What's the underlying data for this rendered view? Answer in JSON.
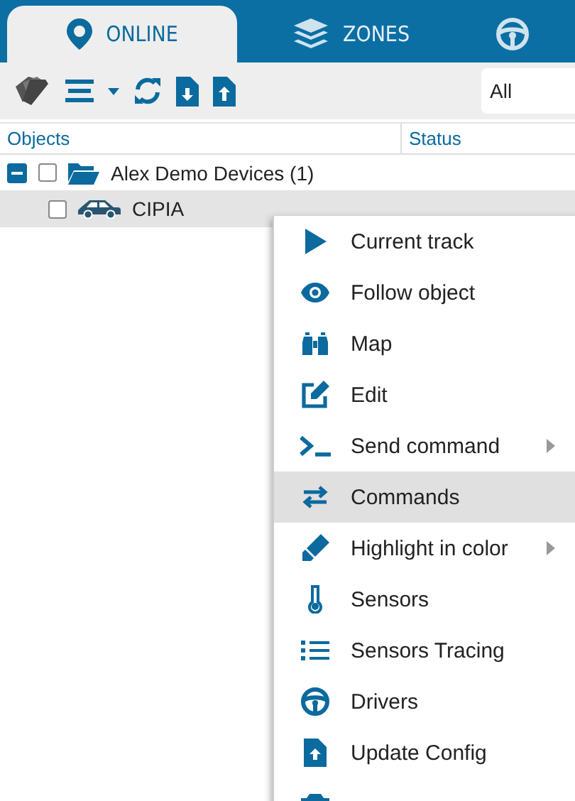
{
  "tabs": [
    {
      "label": "ONLINE",
      "selected": true
    },
    {
      "label": "ZONES",
      "selected": false
    },
    {
      "selected": false
    }
  ],
  "toolbar": {
    "filter": {
      "value": "All"
    }
  },
  "table": {
    "columns": [
      "Objects",
      "Status"
    ],
    "groups": [
      {
        "name": "Alex Demo Devices (1)",
        "expanded": true,
        "checked": false,
        "objects": [
          {
            "name": "CIPIA",
            "checked": false,
            "selected": true
          }
        ]
      }
    ]
  },
  "context_menu": {
    "items": [
      {
        "label": "Current track",
        "selected": false,
        "submenu": false
      },
      {
        "label": "Follow object",
        "selected": false,
        "submenu": false
      },
      {
        "label": "Map",
        "selected": false,
        "submenu": false
      },
      {
        "label": "Edit",
        "selected": false,
        "submenu": false
      },
      {
        "label": "Send command",
        "selected": false,
        "submenu": true
      },
      {
        "label": "Commands",
        "selected": true,
        "submenu": false
      },
      {
        "label": "Highlight in color",
        "selected": false,
        "submenu": true
      },
      {
        "label": "Sensors",
        "selected": false,
        "submenu": false
      },
      {
        "label": "Sensors Tracing",
        "selected": false,
        "submenu": false
      },
      {
        "label": "Drivers",
        "selected": false,
        "submenu": false
      },
      {
        "label": "Update Config",
        "selected": false,
        "submenu": false
      },
      {
        "selected": false,
        "submenu": false
      }
    ]
  }
}
